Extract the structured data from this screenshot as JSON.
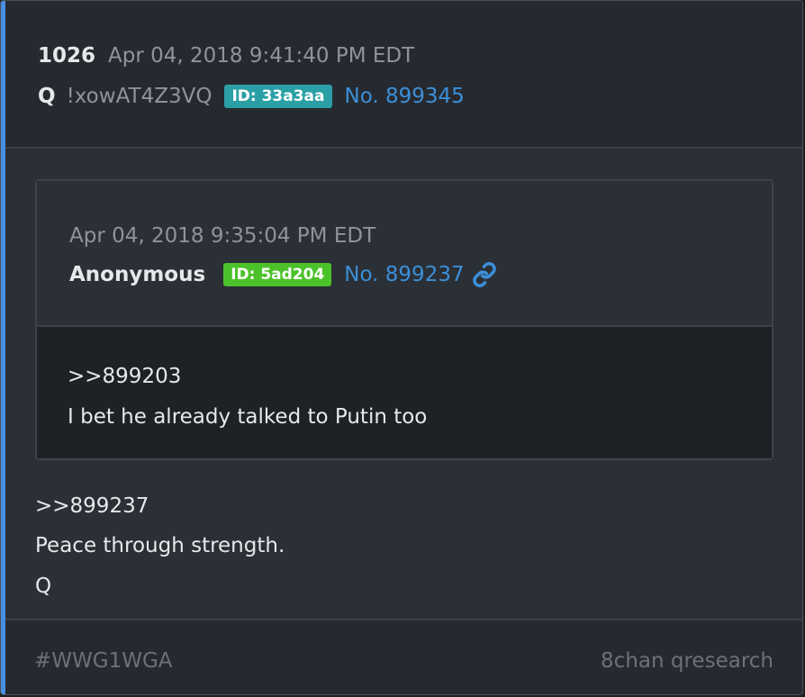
{
  "colors": {
    "accent": "#4a90e2",
    "link": "#3c8fd8",
    "id_badge_q": "#2aa0a6",
    "id_badge_anon": "#4cc22a"
  },
  "post": {
    "number": "1026",
    "date": "Apr 04, 2018 9:41:40 PM EDT",
    "author": "Q",
    "tripcode": "!xowAT4Z3VQ",
    "id_label": "ID: 33a3aa",
    "post_link": "No. 899345",
    "body": [
      ">>899237",
      "Peace through strength.",
      "Q"
    ]
  },
  "quoted": {
    "date": "Apr 04, 2018 9:35:04 PM EDT",
    "author": "Anonymous",
    "id_label": "ID: 5ad204",
    "post_link": "No. 899237",
    "link_icon": "link-icon",
    "body": [
      ">>899203",
      "I bet he already talked to Putin too"
    ]
  },
  "footer": {
    "tag": "#WWG1WGA",
    "source": "8chan qresearch"
  }
}
